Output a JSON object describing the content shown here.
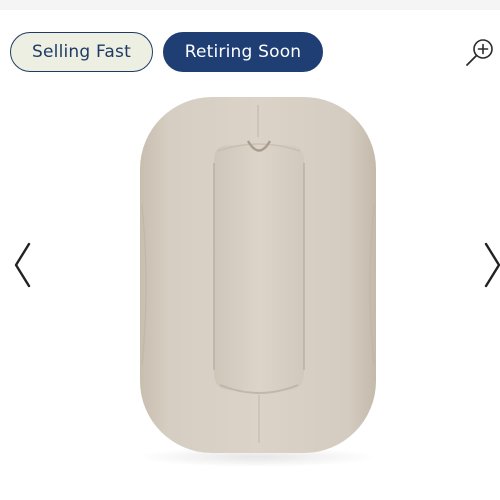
{
  "badges": {
    "selling_fast": "Selling Fast",
    "retiring_soon": "Retiring Soon"
  },
  "icons": {
    "zoom": "zoom-in-icon",
    "prev": "chevron-left-icon",
    "next": "chevron-right-icon"
  },
  "colors": {
    "navy": "#1f3f74",
    "badge_light_bg": "#ecefe2",
    "product": "#d6cec2"
  }
}
